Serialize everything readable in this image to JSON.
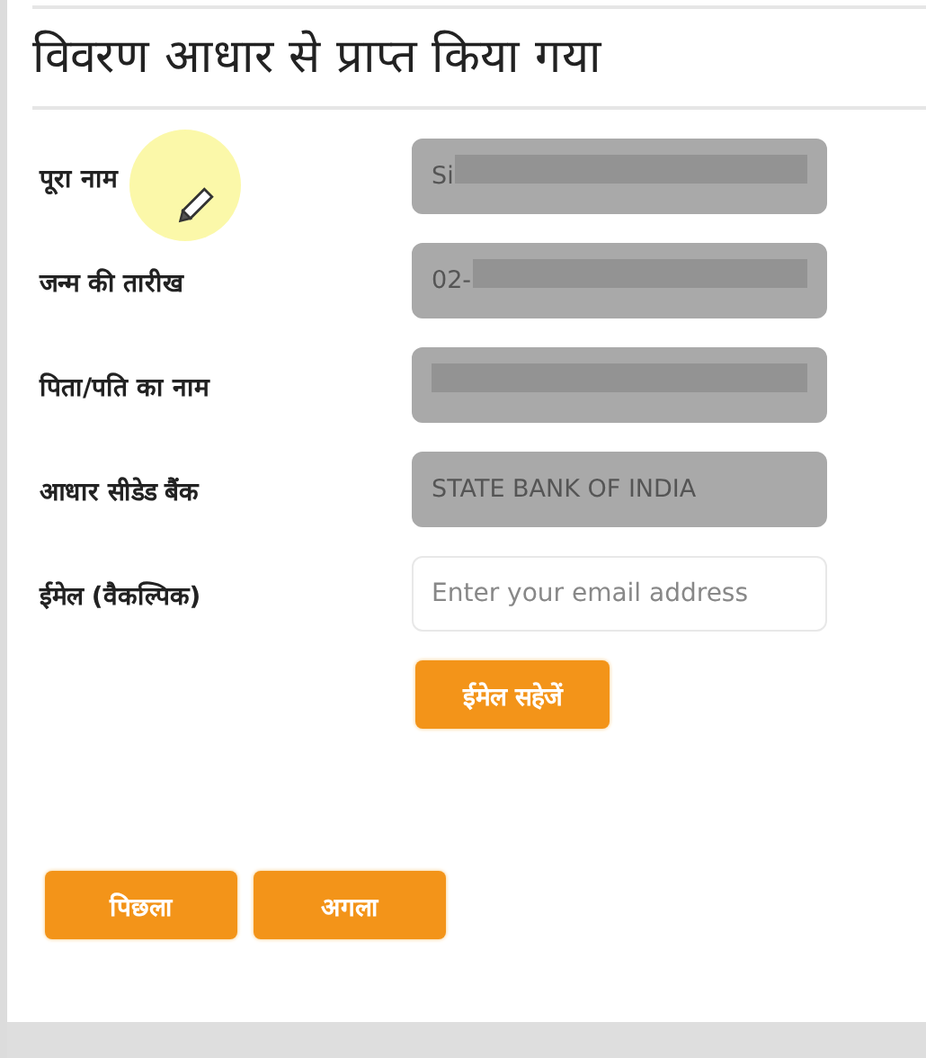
{
  "heading": "विवरण आधार से प्राप्त किया गया",
  "fields": [
    {
      "label": "पूरा नाम",
      "value": "Si",
      "redacted": true,
      "disabled": true
    },
    {
      "label": "जन्म की तारीख",
      "value": "02-",
      "redacted": true,
      "disabled": true
    },
    {
      "label": "पिता/पति का नाम",
      "redacted": true,
      "disabled": true
    },
    {
      "label": "आधार सीडेड बैंक",
      "value": "STATE BANK OF INDIA",
      "redacted": false,
      "disabled": true
    },
    {
      "label": "ईमेल (वैकल्पिक)",
      "placeholder": "Enter your email address",
      "redacted": false,
      "disabled": false
    }
  ],
  "save_button": "ईमेल सहेजें",
  "nav_buttons": [
    "पिछला",
    "अगला"
  ]
}
